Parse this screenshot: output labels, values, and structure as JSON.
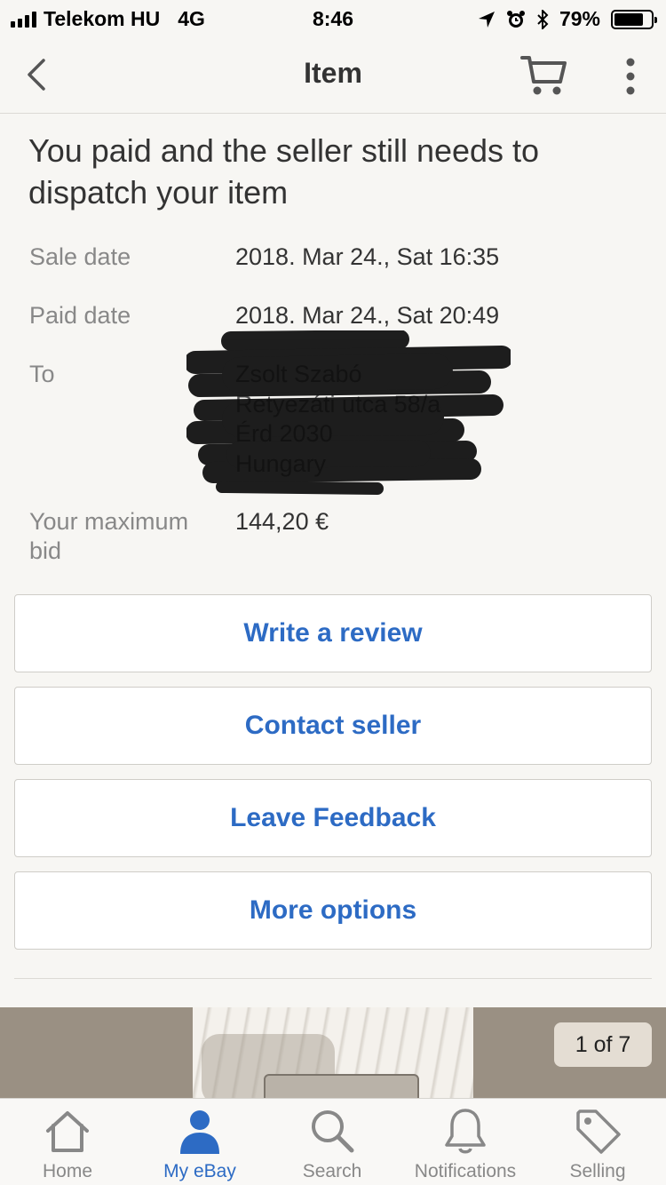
{
  "status_bar": {
    "carrier": "Telekom HU",
    "network": "4G",
    "time": "8:46",
    "battery": "79%",
    "battery_level": 0.79
  },
  "nav": {
    "title": "Item"
  },
  "headline": "You paid and the seller still needs to dispatch your item",
  "details": {
    "sale_date_label": "Sale date",
    "sale_date_value": "2018. Mar 24., Sat 16:35",
    "paid_date_label": "Paid date",
    "paid_date_value": "2018. Mar 24., Sat 20:49",
    "to_label": "To",
    "address": {
      "name": "Zsolt Szabó",
      "street": "Retyezáti utca 58/a",
      "city": "Érd 2030",
      "country": "Hungary"
    },
    "max_bid_label": "Your maximum bid",
    "max_bid_value": "144,20 €"
  },
  "actions": {
    "write_review": "Write a review",
    "contact_seller": "Contact seller",
    "leave_feedback": "Leave Feedback",
    "more_options": "More options"
  },
  "carousel": {
    "page_indicator": "1 of 7"
  },
  "tab_bar": {
    "home": "Home",
    "my_ebay": "My eBay",
    "search": "Search",
    "notifications": "Notifications",
    "selling": "Selling"
  },
  "colors": {
    "accent": "#2d6bc4",
    "background": "#f7f6f3",
    "muted_text": "#888888"
  },
  "icons": {
    "back": "chevron-left-icon",
    "cart": "cart-icon",
    "more": "more-vertical-icon",
    "home": "home-icon",
    "my_ebay": "person-icon",
    "search": "search-icon",
    "notifications": "bell-icon",
    "selling": "tag-icon"
  }
}
